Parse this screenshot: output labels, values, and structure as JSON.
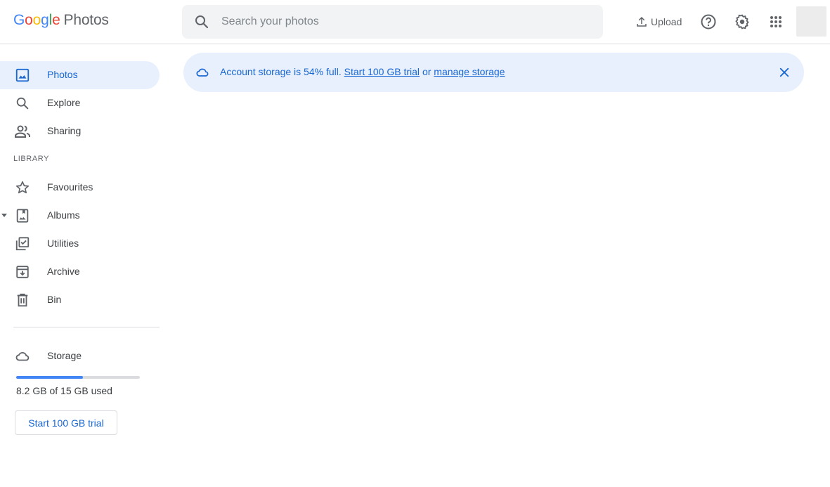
{
  "header": {
    "logo": {
      "letters": [
        "G",
        "o",
        "o",
        "g",
        "l",
        "e"
      ],
      "product": "Photos"
    },
    "search": {
      "placeholder": "Search your photos",
      "value": ""
    },
    "upload_label": "Upload",
    "icons": [
      "help-icon",
      "settings-icon",
      "apps-grid-icon"
    ]
  },
  "banner": {
    "text_prefix": "Account storage is 54% full.",
    "link_trial": "Start 100 GB trial",
    "text_or": "or",
    "link_manage": "manage storage"
  },
  "sidebar": {
    "items": [
      {
        "label": "Photos",
        "icon": "photo-icon",
        "active": true
      },
      {
        "label": "Explore",
        "icon": "search-icon"
      },
      {
        "label": "Sharing",
        "icon": "people-icon"
      }
    ],
    "library_label": "LIBRARY",
    "library_items": [
      {
        "label": "Favourites",
        "icon": "star-icon"
      },
      {
        "label": "Albums",
        "icon": "album-icon"
      },
      {
        "label": "Utilities",
        "icon": "utilities-icon"
      },
      {
        "label": "Archive",
        "icon": "archive-icon"
      },
      {
        "label": "Bin",
        "icon": "trash-icon"
      }
    ],
    "storage": {
      "label": "Storage",
      "used_text": "8.2 GB of 15 GB used",
      "used_fraction": 0.54,
      "trial_button": "Start 100 GB trial"
    }
  },
  "colors": {
    "accent": "#1967d2",
    "banner_bg": "#e8f0fe",
    "bar_fill": "#4285f4"
  }
}
